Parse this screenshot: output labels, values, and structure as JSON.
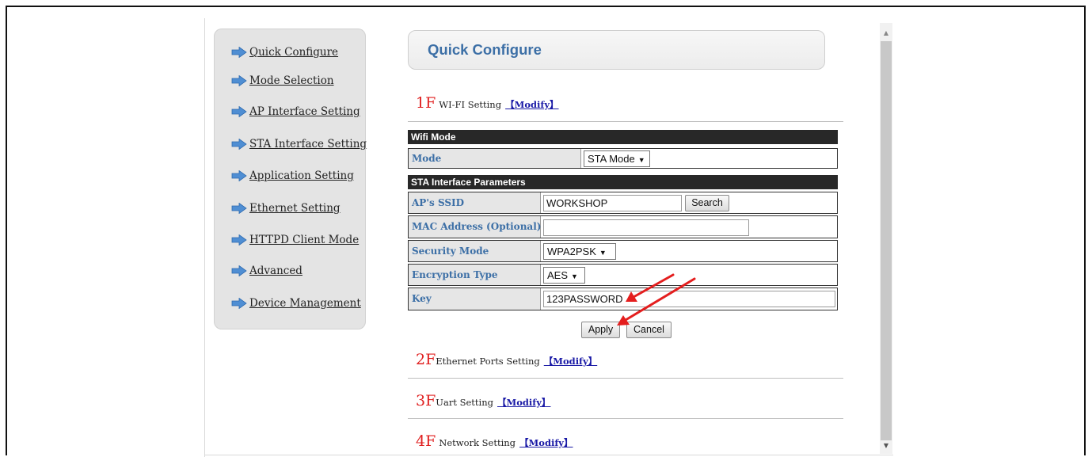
{
  "sidebar": {
    "items": [
      {
        "label": "Quick Configure"
      },
      {
        "label": "Mode Selection"
      },
      {
        "label": "AP Interface Setting"
      },
      {
        "label": "STA Interface Setting"
      },
      {
        "label": "Application Setting"
      },
      {
        "label": "Ethernet Setting"
      },
      {
        "label": "HTTPD Client Mode"
      },
      {
        "label": "Advanced"
      },
      {
        "label": "Device Management"
      }
    ],
    "icon": "arrow-right-icon"
  },
  "page": {
    "title": "Quick Configure"
  },
  "sections": [
    {
      "num": "1F",
      "name": "WI-FI Setting",
      "modify": "【Modify】"
    },
    {
      "num": "2F",
      "name": "Ethernet Ports Setting",
      "modify": "【Modify】"
    },
    {
      "num": "3F",
      "name": "Uart Setting",
      "modify": "【Modify】"
    },
    {
      "num": "4F",
      "name": "Network Setting",
      "modify": "【Modify】"
    }
  ],
  "form": {
    "wifi_mode_header": "Wifi Mode",
    "mode_label": "Mode",
    "mode_value": "STA Mode",
    "sta_header": "STA Interface Parameters",
    "ssid_label": "AP's SSID",
    "ssid_value": "WORKSHOP",
    "search_label": "Search",
    "mac_label": "MAC Address (Optional)",
    "mac_value": "",
    "security_label": "Security Mode",
    "security_value": "WPA2PSK",
    "encryption_label": "Encryption Type",
    "encryption_value": "AES",
    "key_label": "Key",
    "key_value": "123PASSWORD",
    "apply_label": "Apply",
    "cancel_label": "Cancel"
  },
  "colors": {
    "accent": "#3c6fa6",
    "section_number": "#e02020",
    "modify_link": "#1a1aa6",
    "annotation_arrow": "#e41e1e",
    "header_bar": "#282828"
  }
}
